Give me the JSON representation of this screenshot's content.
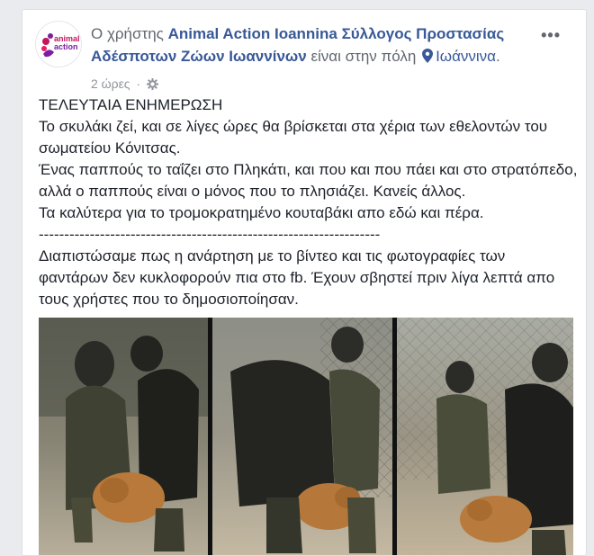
{
  "post": {
    "prefix": "Ο χρήστης",
    "page_name": "Animal Action Ioannina Σύλλογος Προστασίας Αδέσποτων Ζώων Ιωαννίνων",
    "in_city": "είναι στην πόλη",
    "city": "Ιωάννινα",
    "period": ".",
    "time": "2 ώρες",
    "separator": "·",
    "more": "•••",
    "logo_text": "animal action",
    "paragraphs": [
      "ΤΕΛΕΥΤΑΙΑ ΕΝΗΜΕΡΩΣΗ",
      "Το σκυλάκι ζεί, και σε λίγες ώρες θα βρίσκεται στα χέρια των εθελοντών του σωματείου Κόνιτσας.",
      "Ένας παππούς το ταΐζει στο Πληκάτι, και που και που πάει και στο στρατόπεδο, αλλά ο παππούς είναι ο μόνος που το πλησιάζει. Κανείς άλλος.",
      "Τα καλύτερα για το τρομοκρατημένο κουταβάκι απο εδώ και πέρα.",
      "--------------------------------------------------------------------------",
      "Διαπιστώσαμε πως η ανάρτηση με το βίντεο και τις φωτογραφίες των φαντάρων δεν κυκλοφορούν πια στο fb. Έχουν σβηστεί πριν λίγα λεπτά απο τους χρήστες που το δημοσιοποίησαν."
    ]
  },
  "colors": {
    "link": "#385898",
    "meta": "#90949c",
    "text": "#1d2129",
    "logo_pink": "#c2185b",
    "logo_purple": "#7b1fa2"
  },
  "icons": [
    "location-pin-icon",
    "globe-gear-icon",
    "more-options-icon"
  ]
}
